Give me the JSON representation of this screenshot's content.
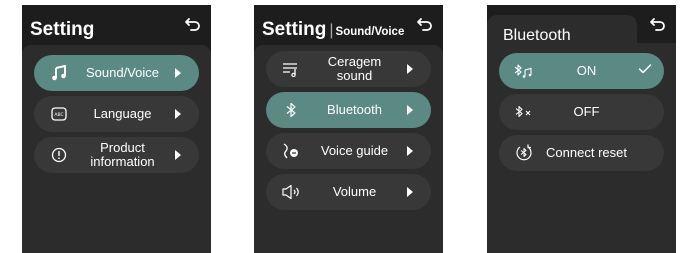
{
  "screen1": {
    "title": "Setting",
    "items": [
      {
        "label": "Sound/Voice",
        "active": true
      },
      {
        "label": "Language",
        "active": false
      },
      {
        "label_line1": "Product",
        "label_line2": "information",
        "active": false
      }
    ]
  },
  "screen2": {
    "title": "Setting",
    "separator": "|",
    "subtitle": "Sound/Voice",
    "items": [
      {
        "label_line1": "Ceragem",
        "label_line2": "sound",
        "active": false
      },
      {
        "label": "Bluetooth",
        "active": true
      },
      {
        "label": "Voice guide",
        "active": false
      },
      {
        "label": "Volume",
        "active": false
      }
    ]
  },
  "screen3": {
    "title": "Bluetooth",
    "items": [
      {
        "label": "ON",
        "active": true,
        "checked": true
      },
      {
        "label": "OFF",
        "active": false
      },
      {
        "label": "Connect reset",
        "active": false
      }
    ]
  },
  "colors": {
    "accent": "#5b8a85",
    "panel_bg": "#1d1d1d",
    "content_bg": "#2c2c2c",
    "pill_bg": "#383838"
  }
}
